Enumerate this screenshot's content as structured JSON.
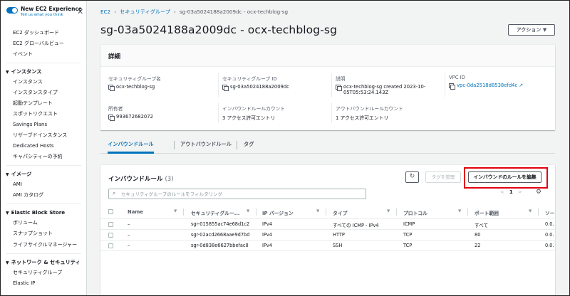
{
  "sidebar": {
    "new_experience_title": "New EC2 Experience",
    "new_experience_link": "Tell us what you think",
    "top_items": [
      "EC2 ダッシュボード",
      "EC2 グローバルビュー",
      "イベント"
    ],
    "sections": [
      {
        "title": "インスタンス",
        "items": [
          "インスタンス",
          "インスタンスタイプ",
          "起動テンプレート",
          "スポットリクエスト",
          "Savings Plans",
          "リザーブドインスタンス",
          "Dedicated Hosts",
          "キャパシティーの予約"
        ]
      },
      {
        "title": "イメージ",
        "items": [
          "AMI",
          "AMI カタログ"
        ]
      },
      {
        "title": "Elastic Block Store",
        "items": [
          "ボリューム",
          "スナップショット",
          "ライフサイクルマネージャー"
        ]
      },
      {
        "title": "ネットワーク & セキュリティ",
        "items": [
          "セキュリティグループ",
          "Elastic IP"
        ]
      }
    ]
  },
  "breadcrumb": {
    "root": "EC2",
    "parent": "セキュリティグループ",
    "current": "sg-03a5024188a2009dc - ocx-techblog-sg"
  },
  "page": {
    "title": "sg-03a5024188a2009dc - ocx-techblog-sg",
    "action_label": "アクション ▼"
  },
  "details": {
    "header": "詳細",
    "fields": {
      "sg_name": {
        "label": "セキュリティグループ名",
        "value": "ocx-techblog-sg"
      },
      "sg_id": {
        "label": "セキュリティグループ ID",
        "value": "sg-03a5024188a2009dc"
      },
      "description": {
        "label": "説明",
        "value_line1": "ocx-techblog-sg created 2023-10-",
        "value_line2": "05T05:53:24.143Z"
      },
      "vpc_id": {
        "label": "VPC ID",
        "value": "vpc-0da2518d8538efd4c"
      },
      "owner": {
        "label": "所有者",
        "value": "993672682072"
      },
      "inbound_count": {
        "label": "インバウンドルールカウント",
        "value": "3 アクセス許可エントリ"
      },
      "outbound_count": {
        "label": "アウトバウンドルールカウント",
        "value": "1 アクセス許可エントリ"
      }
    }
  },
  "tabs": [
    "インバウンドルール",
    "アウトバウンドルール",
    "タグ"
  ],
  "rules": {
    "title": "インバウンドルール",
    "count": "(3)",
    "manage_tags_label": "タグを管理",
    "edit_label": "インバウンドのルールを編集",
    "filter_placeholder": "セキュリティグループのルールをフィルタリング",
    "page_prev": "<",
    "page_num": "1",
    "page_next": ">",
    "columns": [
      "Name",
      "セキュリティグルー...",
      "IP バージョン",
      "タイプ",
      "プロトコル",
      "ポート範囲",
      "ソー"
    ],
    "rows": [
      {
        "name": "–",
        "rule_id": "sgr-015855ac74e68d1c2",
        "ip": "IPv4",
        "type": "すべての ICMP - IPv4",
        "protocol": "ICMP",
        "port": "すべて",
        "source": "0.0."
      },
      {
        "name": "–",
        "rule_id": "sgr-02acd2668aae9d7bd",
        "ip": "IPv4",
        "type": "HTTP",
        "protocol": "TCP",
        "port": "80",
        "source": "0.0."
      },
      {
        "name": "–",
        "rule_id": "sgr-0d838e6627bbefac8",
        "ip": "IPv4",
        "type": "SSH",
        "protocol": "TCP",
        "port": "22",
        "source": "0.0."
      }
    ]
  },
  "colors": {
    "link": "#0073bb",
    "highlight": "#e3000f",
    "background": "#f2f3f3"
  }
}
